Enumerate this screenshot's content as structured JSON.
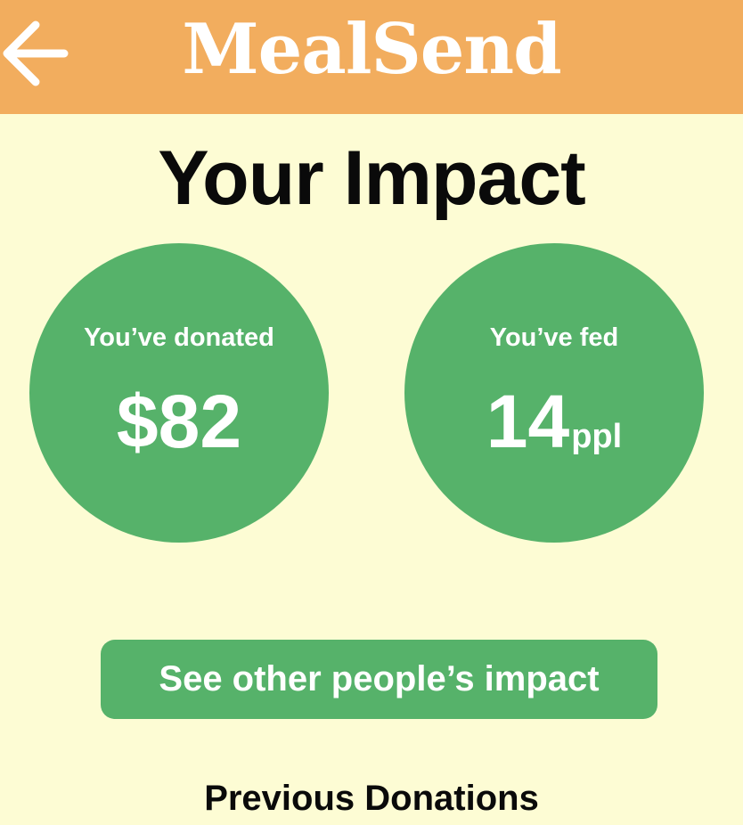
{
  "header": {
    "app_title": "MealSend",
    "back_icon": "arrow-left-icon",
    "background_color": "#f2ad5e"
  },
  "page": {
    "title": "Your Impact",
    "background_color": "#fdfcd4"
  },
  "stats": {
    "donated": {
      "label": "You’ve donated",
      "value": "$82"
    },
    "fed": {
      "label": "You’ve fed",
      "value": "14",
      "unit": "ppl"
    },
    "circle_color": "#56b26a"
  },
  "actions": {
    "see_others_label": "See other people’s impact",
    "button_color": "#56b26a"
  },
  "sections": {
    "previous_donations_title": "Previous Donations"
  }
}
